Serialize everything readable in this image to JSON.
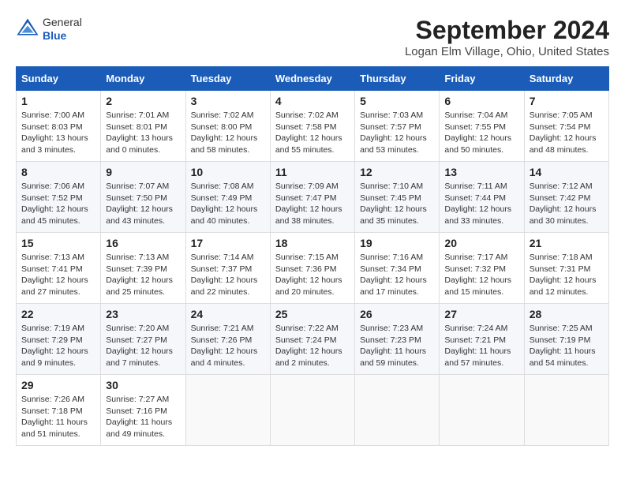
{
  "header": {
    "logo_line1": "General",
    "logo_line2": "Blue",
    "title": "September 2024",
    "subtitle": "Logan Elm Village, Ohio, United States"
  },
  "days_of_week": [
    "Sunday",
    "Monday",
    "Tuesday",
    "Wednesday",
    "Thursday",
    "Friday",
    "Saturday"
  ],
  "weeks": [
    [
      {
        "day": "1",
        "info": "Sunrise: 7:00 AM\nSunset: 8:03 PM\nDaylight: 13 hours\nand 3 minutes."
      },
      {
        "day": "2",
        "info": "Sunrise: 7:01 AM\nSunset: 8:01 PM\nDaylight: 13 hours\nand 0 minutes."
      },
      {
        "day": "3",
        "info": "Sunrise: 7:02 AM\nSunset: 8:00 PM\nDaylight: 12 hours\nand 58 minutes."
      },
      {
        "day": "4",
        "info": "Sunrise: 7:02 AM\nSunset: 7:58 PM\nDaylight: 12 hours\nand 55 minutes."
      },
      {
        "day": "5",
        "info": "Sunrise: 7:03 AM\nSunset: 7:57 PM\nDaylight: 12 hours\nand 53 minutes."
      },
      {
        "day": "6",
        "info": "Sunrise: 7:04 AM\nSunset: 7:55 PM\nDaylight: 12 hours\nand 50 minutes."
      },
      {
        "day": "7",
        "info": "Sunrise: 7:05 AM\nSunset: 7:54 PM\nDaylight: 12 hours\nand 48 minutes."
      }
    ],
    [
      {
        "day": "8",
        "info": "Sunrise: 7:06 AM\nSunset: 7:52 PM\nDaylight: 12 hours\nand 45 minutes."
      },
      {
        "day": "9",
        "info": "Sunrise: 7:07 AM\nSunset: 7:50 PM\nDaylight: 12 hours\nand 43 minutes."
      },
      {
        "day": "10",
        "info": "Sunrise: 7:08 AM\nSunset: 7:49 PM\nDaylight: 12 hours\nand 40 minutes."
      },
      {
        "day": "11",
        "info": "Sunrise: 7:09 AM\nSunset: 7:47 PM\nDaylight: 12 hours\nand 38 minutes."
      },
      {
        "day": "12",
        "info": "Sunrise: 7:10 AM\nSunset: 7:45 PM\nDaylight: 12 hours\nand 35 minutes."
      },
      {
        "day": "13",
        "info": "Sunrise: 7:11 AM\nSunset: 7:44 PM\nDaylight: 12 hours\nand 33 minutes."
      },
      {
        "day": "14",
        "info": "Sunrise: 7:12 AM\nSunset: 7:42 PM\nDaylight: 12 hours\nand 30 minutes."
      }
    ],
    [
      {
        "day": "15",
        "info": "Sunrise: 7:13 AM\nSunset: 7:41 PM\nDaylight: 12 hours\nand 27 minutes."
      },
      {
        "day": "16",
        "info": "Sunrise: 7:13 AM\nSunset: 7:39 PM\nDaylight: 12 hours\nand 25 minutes."
      },
      {
        "day": "17",
        "info": "Sunrise: 7:14 AM\nSunset: 7:37 PM\nDaylight: 12 hours\nand 22 minutes."
      },
      {
        "day": "18",
        "info": "Sunrise: 7:15 AM\nSunset: 7:36 PM\nDaylight: 12 hours\nand 20 minutes."
      },
      {
        "day": "19",
        "info": "Sunrise: 7:16 AM\nSunset: 7:34 PM\nDaylight: 12 hours\nand 17 minutes."
      },
      {
        "day": "20",
        "info": "Sunrise: 7:17 AM\nSunset: 7:32 PM\nDaylight: 12 hours\nand 15 minutes."
      },
      {
        "day": "21",
        "info": "Sunrise: 7:18 AM\nSunset: 7:31 PM\nDaylight: 12 hours\nand 12 minutes."
      }
    ],
    [
      {
        "day": "22",
        "info": "Sunrise: 7:19 AM\nSunset: 7:29 PM\nDaylight: 12 hours\nand 9 minutes."
      },
      {
        "day": "23",
        "info": "Sunrise: 7:20 AM\nSunset: 7:27 PM\nDaylight: 12 hours\nand 7 minutes."
      },
      {
        "day": "24",
        "info": "Sunrise: 7:21 AM\nSunset: 7:26 PM\nDaylight: 12 hours\nand 4 minutes."
      },
      {
        "day": "25",
        "info": "Sunrise: 7:22 AM\nSunset: 7:24 PM\nDaylight: 12 hours\nand 2 minutes."
      },
      {
        "day": "26",
        "info": "Sunrise: 7:23 AM\nSunset: 7:23 PM\nDaylight: 11 hours\nand 59 minutes."
      },
      {
        "day": "27",
        "info": "Sunrise: 7:24 AM\nSunset: 7:21 PM\nDaylight: 11 hours\nand 57 minutes."
      },
      {
        "day": "28",
        "info": "Sunrise: 7:25 AM\nSunset: 7:19 PM\nDaylight: 11 hours\nand 54 minutes."
      }
    ],
    [
      {
        "day": "29",
        "info": "Sunrise: 7:26 AM\nSunset: 7:18 PM\nDaylight: 11 hours\nand 51 minutes."
      },
      {
        "day": "30",
        "info": "Sunrise: 7:27 AM\nSunset: 7:16 PM\nDaylight: 11 hours\nand 49 minutes."
      },
      {
        "day": "",
        "info": ""
      },
      {
        "day": "",
        "info": ""
      },
      {
        "day": "",
        "info": ""
      },
      {
        "day": "",
        "info": ""
      },
      {
        "day": "",
        "info": ""
      }
    ]
  ]
}
